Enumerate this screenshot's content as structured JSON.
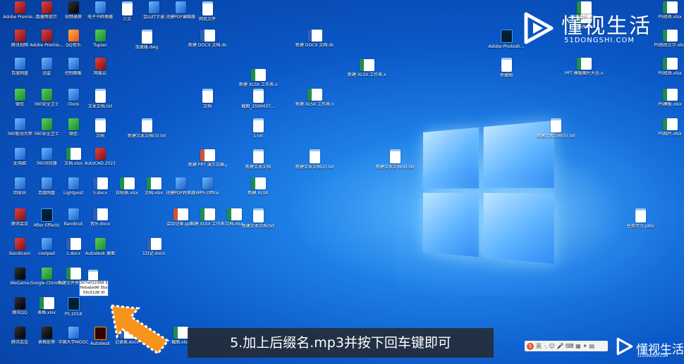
{
  "desktop": {
    "icons": [
      {
        "label": "Adobe Premie...",
        "kind": "app4"
      },
      {
        "label": "数据等提示",
        "kind": "app4"
      },
      {
        "label": "视频录屏",
        "kind": "app5"
      },
      {
        "label": "电子书转换器",
        "kind": "app3"
      },
      {
        "label": "三文",
        "kind": "doc"
      },
      {
        "label": "金山打字通",
        "kind": "app3"
      },
      {
        "label": "迅捷PDF编辑器",
        "kind": "app3"
      },
      {
        "label": "网页文件",
        "kind": "doc"
      },
      {
        "label": "腾讯视频",
        "kind": "app4"
      },
      {
        "label": "Adobe Premie...",
        "kind": "app4"
      },
      {
        "label": "QQ音乐",
        "kind": "app"
      },
      {
        "label": "Tupian",
        "kind": "app2"
      },
      {
        "label": "加速器.dwg",
        "kind": "doc"
      },
      {
        "label": "新建 DOCX 文档.docx",
        "kind": "docx"
      },
      {
        "label": "新建 DOCX 文档.docx",
        "kind": "docx"
      },
      {
        "label": "百度网盘",
        "kind": "app3"
      },
      {
        "label": "迅雷",
        "kind": "app3"
      },
      {
        "label": "控制面板",
        "kind": "app3"
      },
      {
        "label": "网易云",
        "kind": "app4"
      },
      {
        "label": "新建 XLSX 工作表.xlsx",
        "kind": "xls"
      },
      {
        "label": "新建 XLSX 工作表.xlsx",
        "kind": "xls"
      },
      {
        "label": "微信",
        "kind": "app2"
      },
      {
        "label": "360安全卫士",
        "kind": "app2"
      },
      {
        "label": "iTools",
        "kind": "app3"
      },
      {
        "label": "文本文档.txt",
        "kind": "doc"
      },
      {
        "label": "文档",
        "kind": "doc"
      },
      {
        "label": "截图_1590437...",
        "kind": "doc"
      },
      {
        "label": "新建 XLSX 工作表.xlsx",
        "kind": "xls"
      },
      {
        "label": "360驱动大师",
        "kind": "app3"
      },
      {
        "label": "360安全卫士",
        "kind": "app2"
      },
      {
        "label": "微信",
        "kind": "app2"
      },
      {
        "label": "文档",
        "kind": "doc"
      },
      {
        "label": "新建文本文档(3).txt",
        "kind": "doc"
      },
      {
        "label": "1.txt",
        "kind": "doc"
      },
      {
        "label": "此电脑",
        "kind": "app3"
      },
      {
        "label": "360浏览器",
        "kind": "app3"
      },
      {
        "label": "文档.xlsx",
        "kind": "xls"
      },
      {
        "label": "AutoCAD 2021",
        "kind": "app4"
      },
      {
        "label": "新建 PPT 演示文稿.ppt",
        "kind": "ppt"
      },
      {
        "label": "新建文本文档",
        "kind": "doc"
      },
      {
        "label": "新建文本文档(2).txt",
        "kind": "doc"
      },
      {
        "label": "新建文本文档(4).txt",
        "kind": "doc"
      },
      {
        "label": "回收站",
        "kind": "app3"
      },
      {
        "label": "百度网盘",
        "kind": "app3"
      },
      {
        "label": "Lightpost",
        "kind": "app3"
      },
      {
        "label": "5.docx",
        "kind": "docx"
      },
      {
        "label": "日程表.xlsx",
        "kind": "xls"
      },
      {
        "label": "文档.xlsx",
        "kind": "xls"
      },
      {
        "label": "迅捷PDF转换器",
        "kind": "app3"
      },
      {
        "label": "WPS Office",
        "kind": "app3"
      },
      {
        "label": "新建 XLSX",
        "kind": "xls"
      },
      {
        "label": "腾讯会议",
        "kind": "app4"
      },
      {
        "label": "After Effects",
        "kind": "ps"
      },
      {
        "label": "Bandicut",
        "kind": "app3"
      },
      {
        "label": "音乐.docx",
        "kind": "docx"
      },
      {
        "label": "会议记录.pptx",
        "kind": "ppt"
      },
      {
        "label": "新建 XLSX 工作表",
        "kind": "xls"
      },
      {
        "label": "文档.xlsx",
        "kind": "xls"
      },
      {
        "label": "新建文本文档.txt",
        "kind": "doc"
      },
      {
        "label": "Bandicam",
        "kind": "app4"
      },
      {
        "label": "coolpad",
        "kind": "app3"
      },
      {
        "label": "1.docx",
        "kind": "docx"
      },
      {
        "label": "Autodesk 桌面",
        "kind": "app2"
      },
      {
        "label": "1日记.docx",
        "kind": "docx"
      },
      {
        "label": "WeGame",
        "kind": "app5"
      },
      {
        "label": "Google Chrome",
        "kind": "app2"
      },
      {
        "label": "新建文件夹.xlsx",
        "kind": "xls"
      },
      {
        "label": "腾讯QQ",
        "kind": "app5"
      },
      {
        "label": "表格.xlsx",
        "kind": "xls"
      },
      {
        "label": "PS 2018",
        "kind": "ps"
      },
      {
        "label": "腾讯会议",
        "kind": "app5"
      },
      {
        "label": "表格处理",
        "kind": "app5"
      },
      {
        "label": "中国大学MOOC",
        "kind": "app3"
      },
      {
        "label": "Autodesk",
        "kind": "ai"
      },
      {
        "label": "记录表.docx",
        "kind": "docx"
      },
      {
        "label": "截图.xlsx",
        "kind": "xls"
      },
      {
        "label": "Adobe Photosh...",
        "kind": "ps"
      },
      {
        "label": "步骤图",
        "kind": "doc"
      },
      {
        "label": "PPT 模板图片大全.xlsx",
        "kind": "xls"
      },
      {
        "label": "新建文本文档(5).txt",
        "kind": "doc"
      },
      {
        "label": "PS修改.xlsx",
        "kind": "xls"
      },
      {
        "label": "PS修改文字.xlsx",
        "kind": "xls"
      },
      {
        "label": "PS修改.xlsx",
        "kind": "xls"
      },
      {
        "label": "PS修改.xlsx",
        "kind": "xls"
      },
      {
        "label": "PS模板.xlsx",
        "kind": "xls"
      },
      {
        "label": "PS照片.xlsx",
        "kind": "xls"
      },
      {
        "label": "PPT 图标.xlsx",
        "kind": "xls"
      },
      {
        "label": "任务学习.jobs",
        "kind": "doc"
      }
    ],
    "renaming": {
      "text": "307e022368 5ffebabe96 5ba59c51d8 9f"
    }
  },
  "caption": {
    "text": "5.加上后缀名.mp3并按下回车键即可"
  },
  "watermark": {
    "main": "懂视生活",
    "sub": "51DONGSHI.COM",
    "corner_main": "懂视生活",
    "corner_sub": "51DONGSHI.COM"
  },
  "tray": {
    "ime_badge": "S",
    "ime_mode": "英",
    "symbols": "·, ☺ 🎤 ⌨ ▦ ✦ ▤"
  },
  "colors": {
    "desktop_bg": "#0b58c8",
    "caption_bg": "#262626",
    "arrow_fill": "#f7941d"
  }
}
